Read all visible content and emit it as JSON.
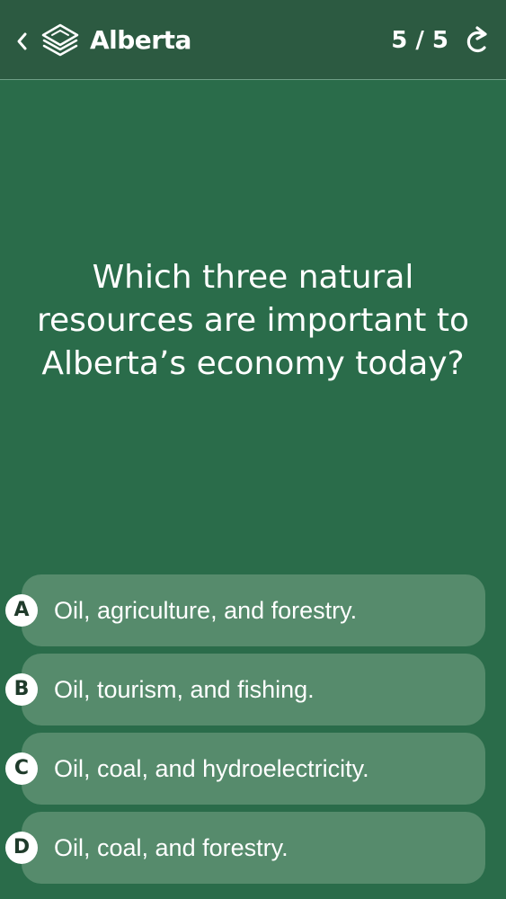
{
  "header": {
    "back_icon": "chevron-left-icon",
    "app_icon": "layers-icon",
    "title": "Alberta",
    "progress": "5 / 5",
    "refresh_icon": "refresh-icon"
  },
  "question": {
    "text": "Which three natural resources are important to Alberta’s economy today?"
  },
  "answers": [
    {
      "letter": "A",
      "text": "Oil, agriculture, and forestry."
    },
    {
      "letter": "B",
      "text": "Oil, tourism, and fishing."
    },
    {
      "letter": "C",
      "text": "Oil, coal, and hydroelectricity."
    },
    {
      "letter": "D",
      "text": "Oil, coal, and forestry."
    }
  ],
  "colors": {
    "background": "#2a6c4a",
    "header": "#2c5a41",
    "answer": "#568b6c",
    "text": "#ffffff"
  }
}
